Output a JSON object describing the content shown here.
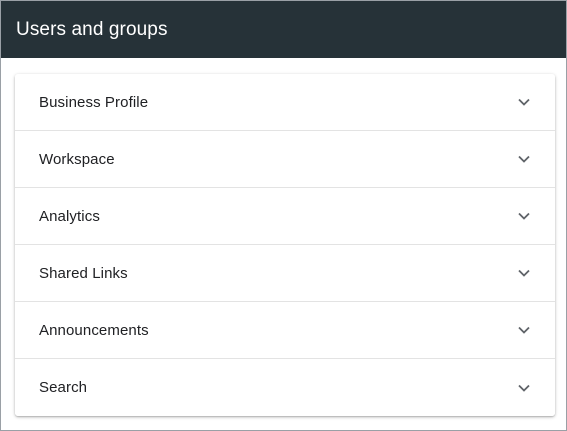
{
  "header": {
    "title": "Users and groups"
  },
  "sections": [
    {
      "label": "Business Profile",
      "icon": "chevron-down-icon"
    },
    {
      "label": "Workspace",
      "icon": "chevron-down-icon"
    },
    {
      "label": "Analytics",
      "icon": "chevron-down-icon"
    },
    {
      "label": "Shared Links",
      "icon": "chevron-down-icon"
    },
    {
      "label": "Announcements",
      "icon": "chevron-down-icon"
    },
    {
      "label": "Search",
      "icon": "chevron-down-icon"
    }
  ],
  "colors": {
    "header_bg": "#263238",
    "header_text": "#ffffff",
    "row_text": "#202124",
    "divider": "#e3e3e3",
    "chevron": "#5f6368"
  }
}
